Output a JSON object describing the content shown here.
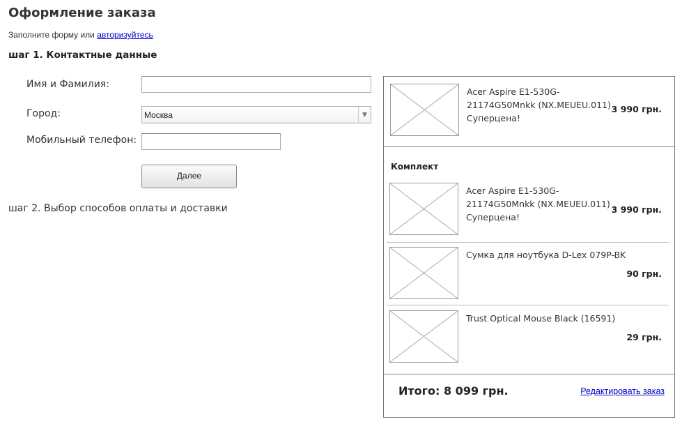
{
  "page": {
    "title": "Оформление заказа",
    "subtitle_prefix": "Заполните форму или ",
    "login_link": "авторизуйтесь"
  },
  "step1": {
    "heading": "шаг 1.  Контактные данные",
    "name_label": "Имя и Фамилия:",
    "name_value": "",
    "city_label": "Город:",
    "city_value": "Москва",
    "phone_label": "Мобильный телефон:",
    "phone_value": "",
    "next_button": "Далее"
  },
  "step2": {
    "heading": "шаг 2.  Выбор способов оплаты и доставки"
  },
  "cart": {
    "main_item": {
      "name": "Acer Aspire E1-530G-21174G50Mnkk (NX.MEUEU.011) Суперцена!",
      "price": "3 990 грн."
    },
    "kit_label": "Комплект",
    "kit_items": [
      {
        "name": "Acer Aspire E1-530G-21174G50Mnkk (NX.MEUEU.011) Суперцена!",
        "price": "3 990 грн."
      },
      {
        "name": "Сумка для ноутбука D-Lex 079P-BK",
        "price": "90 грн."
      },
      {
        "name": "Trust Optical Mouse Black (16591)",
        "price": "29 грн."
      }
    ],
    "total": "Итого: 8 099 грн.",
    "edit_link": "Редактировать заказ"
  }
}
